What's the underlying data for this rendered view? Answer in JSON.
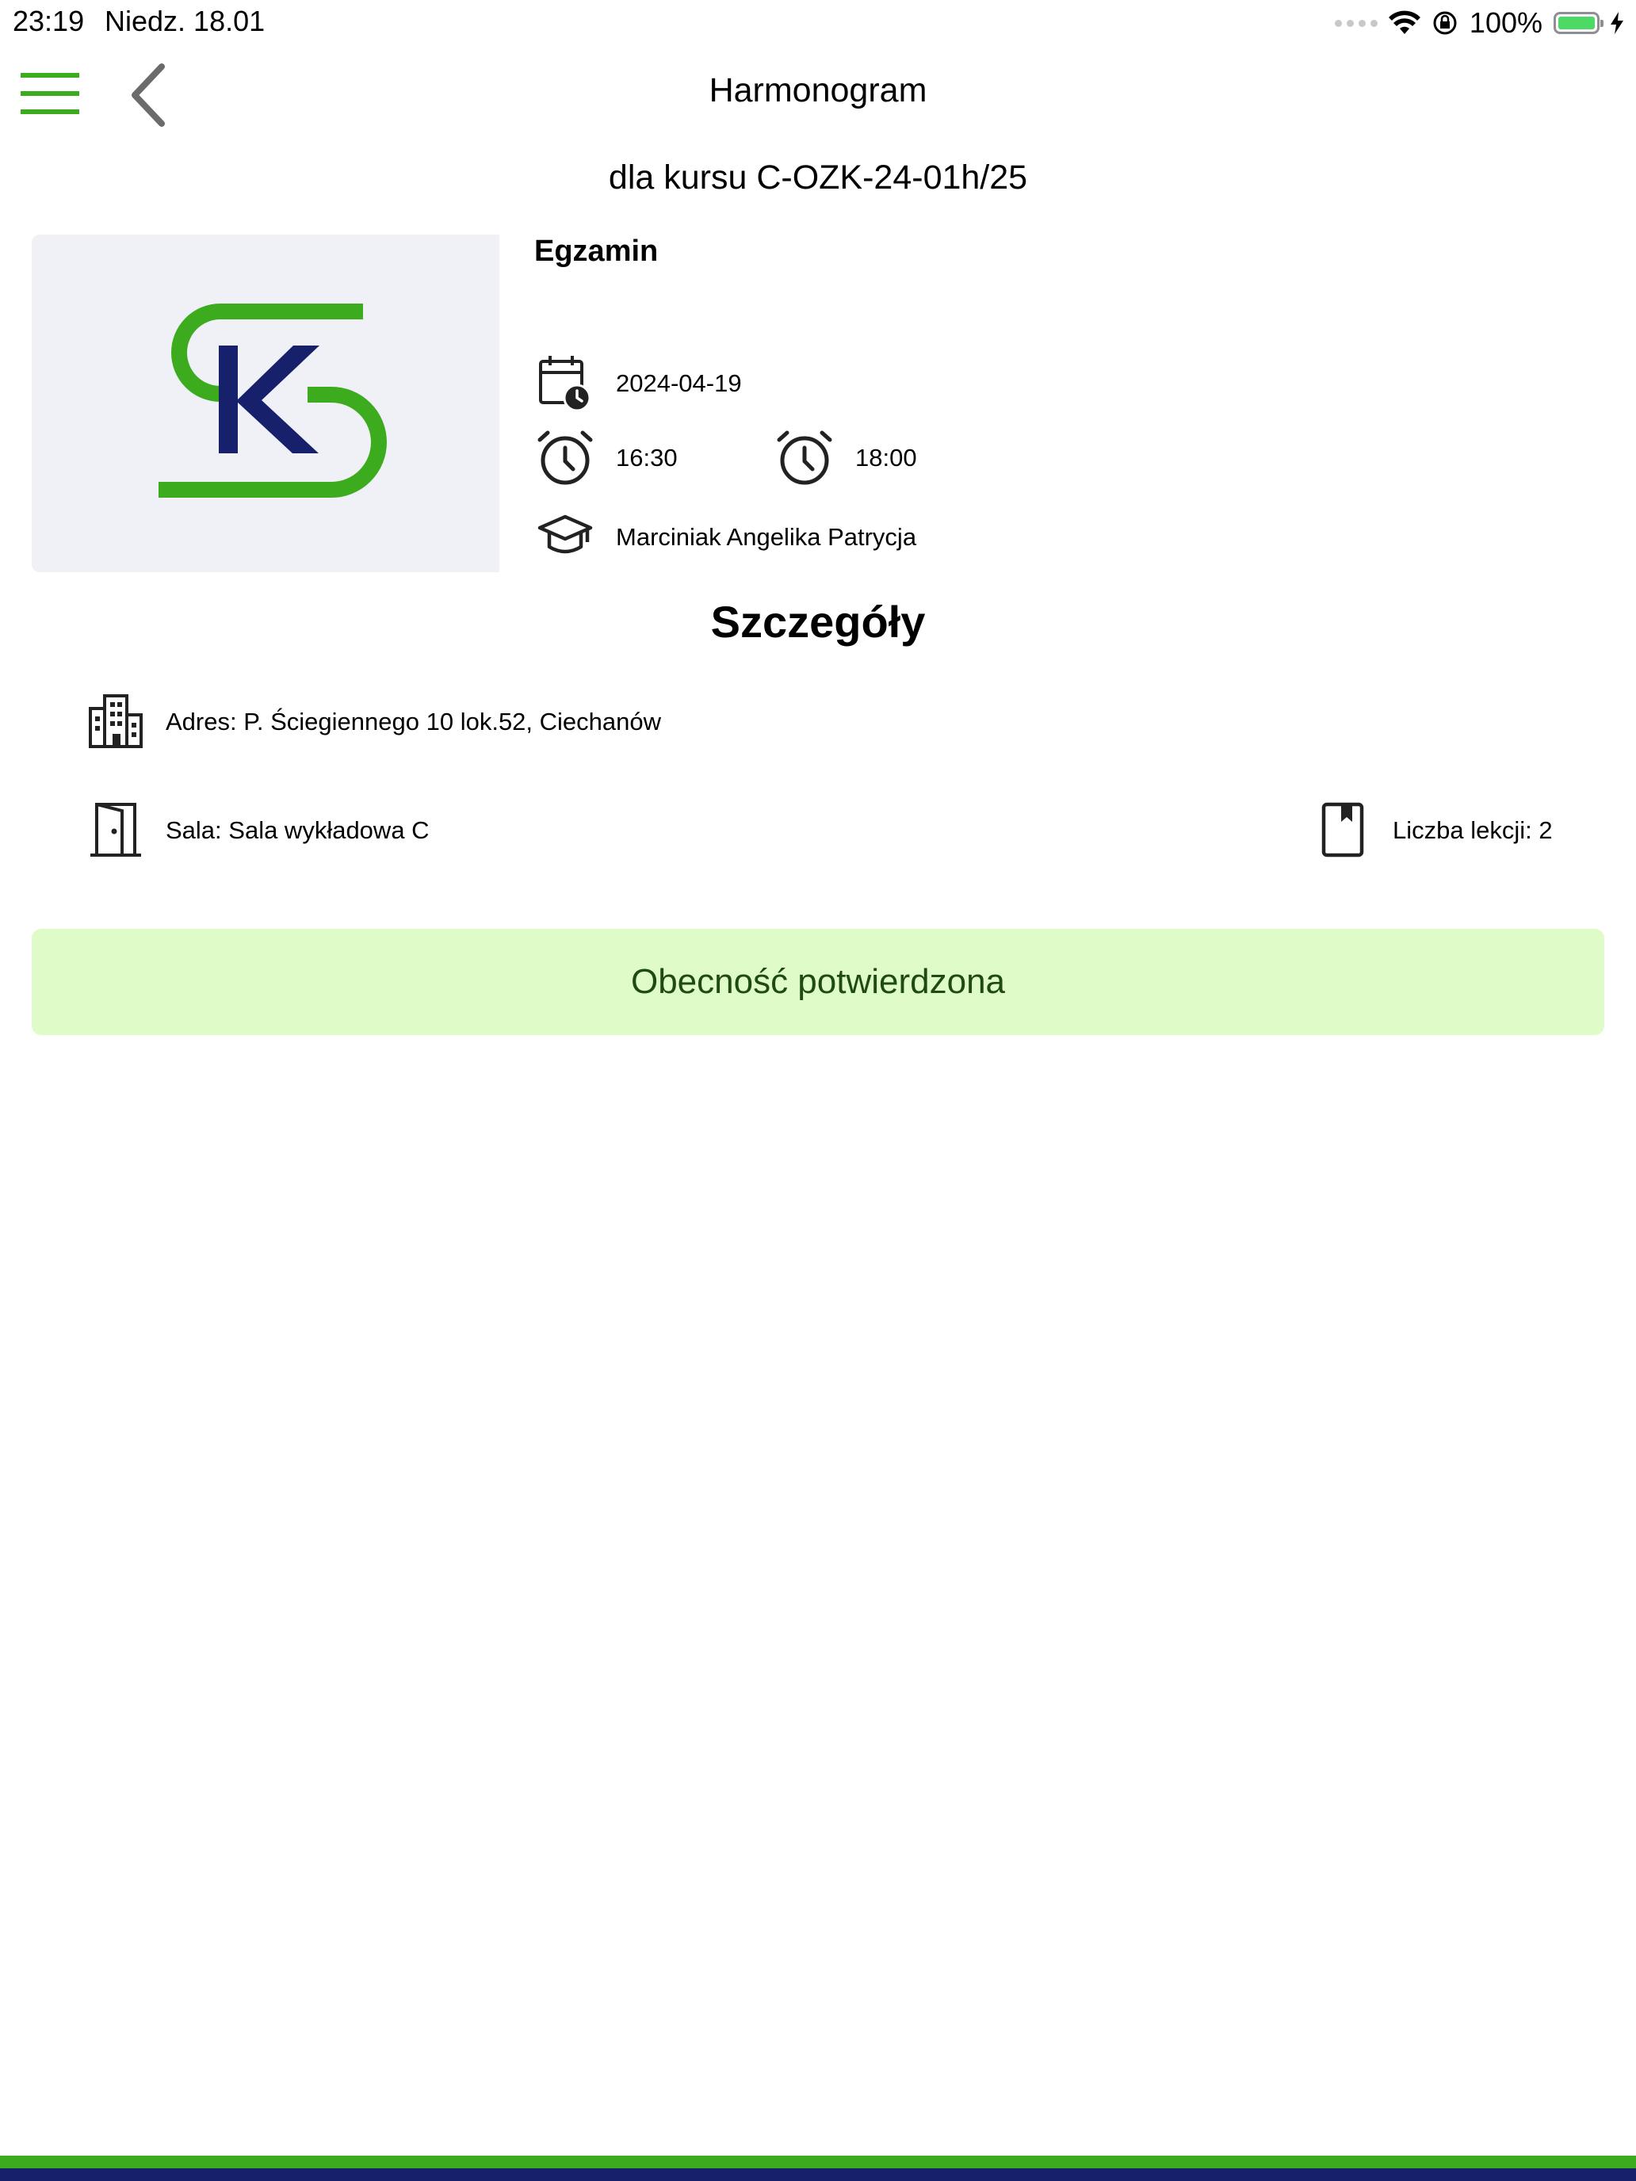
{
  "status_bar": {
    "time": "23:19",
    "date": "Niedz. 18.01",
    "battery": "100%"
  },
  "header": {
    "title": "Harmonogram",
    "subtitle": "dla kursu C-OZK-24-01h/25"
  },
  "event": {
    "title": "Egzamin",
    "date": "2024-04-19",
    "start_time": "16:30",
    "end_time": "18:00",
    "instructor": "Marciniak Angelika Patrycja"
  },
  "details": {
    "heading": "Szczegóły",
    "address": "Adres: P. Ściegiennego 10 lok.52, Ciechanów",
    "room": "Sala: Sala wykładowa C",
    "lessons": "Liczba lekcji: 2"
  },
  "attendance": {
    "label": "Obecność potwierdzona"
  },
  "colors": {
    "brand_green": "#3cac1e",
    "brand_navy": "#16206b",
    "banner_bg": "#dffcc8",
    "banner_text": "#1f4a12"
  },
  "icons": {
    "menu": "hamburger-menu-icon",
    "back": "chevron-left-icon",
    "date": "calendar-clock-icon",
    "time": "alarm-clock-icon",
    "instructor": "graduation-cap-icon",
    "address": "building-icon",
    "room": "door-icon",
    "lessons": "bookmark-book-icon"
  }
}
